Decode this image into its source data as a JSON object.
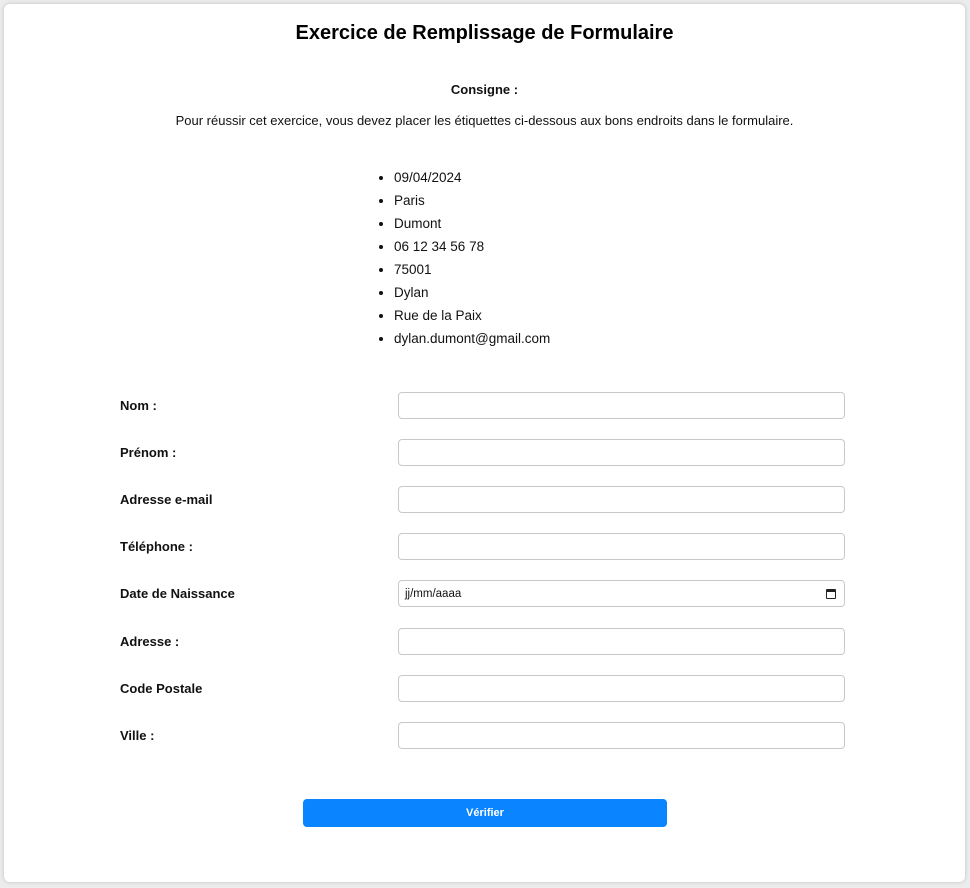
{
  "page": {
    "title": "Exercice de Remplissage de Formulaire"
  },
  "instructions": {
    "heading": "Consigne :",
    "text": "Pour réussir cet exercice, vous devez placer les étiquettes ci-dessous aux bons endroits dans le formulaire."
  },
  "labels": [
    "09/04/2024",
    "Paris",
    "Dumont",
    "06 12 34 56 78",
    "75001",
    "Dylan",
    "Rue de la Paix",
    "dylan.dumont@gmail.com"
  ],
  "form": {
    "fields": [
      {
        "label": "Nom :",
        "value": ""
      },
      {
        "label": "Prénom :",
        "value": ""
      },
      {
        "label": "Adresse e-mail",
        "value": ""
      },
      {
        "label": "Téléphone :",
        "value": ""
      },
      {
        "label": "Date de Naissance",
        "value": "",
        "placeholder": "jj/mm/aaaa"
      },
      {
        "label": "Adresse :",
        "value": ""
      },
      {
        "label": "Code Postale",
        "value": ""
      },
      {
        "label": "Ville :",
        "value": ""
      }
    ],
    "submit_label": "Vérifier"
  },
  "colors": {
    "accent": "#0a84ff",
    "input_border": "#c8c8c8",
    "background": "#ececec",
    "card": "#ffffff"
  },
  "icons": {
    "date_picker": "calendar-icon"
  }
}
